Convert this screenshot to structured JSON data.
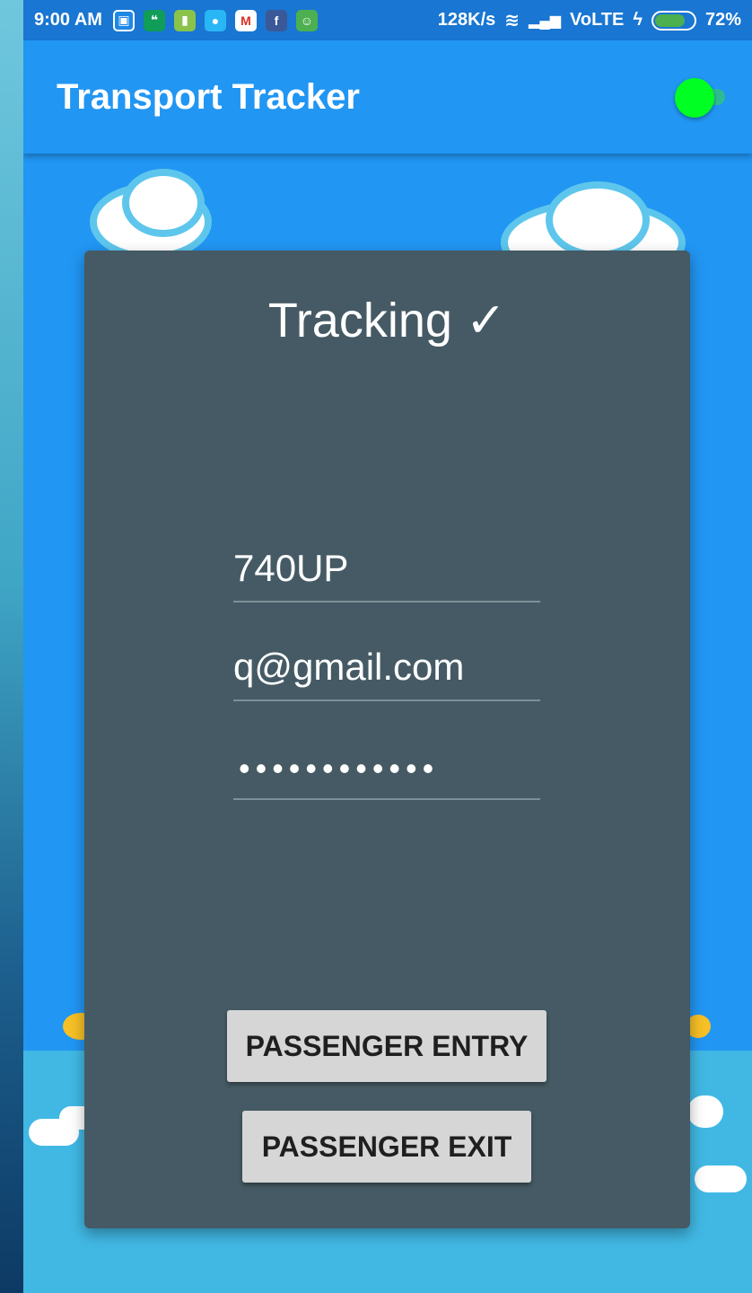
{
  "status_bar": {
    "time": "9:00 AM",
    "notification_icons": [
      "bus-icon",
      "hangouts-icon",
      "battery-app-icon",
      "messenger-icon",
      "gmail-icon",
      "facebook-icon",
      "android-icon"
    ],
    "net_speed": "128K/s",
    "network": "VoLTE",
    "battery": "72%"
  },
  "app_bar": {
    "title": "Transport Tracker",
    "toggle_on": true,
    "toggle_color": "#00ff22"
  },
  "card": {
    "title": "Tracking ✓",
    "route_value": "740UP",
    "email_value": "q@gmail.com",
    "password_mask": "••••••••••••",
    "entry_button": "PASSENGER ENTRY",
    "exit_button": "PASSENGER EXIT"
  },
  "colors": {
    "primary": "#2196f3",
    "status_bar": "#1976d2",
    "card": "#455a64",
    "button": "#d6d6d6"
  }
}
